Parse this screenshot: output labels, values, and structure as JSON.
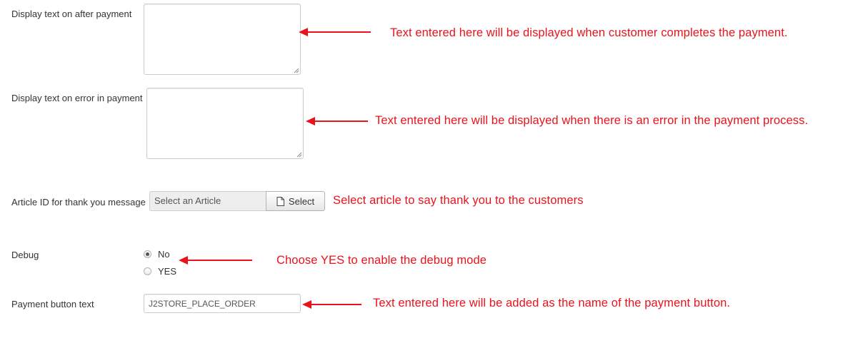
{
  "fields": {
    "after_payment": {
      "label": "Display text on after payment",
      "value": "",
      "note": "Text entered here will be displayed when customer completes the payment."
    },
    "error_payment": {
      "label": "Display text on error in payment",
      "value": "",
      "note": "Text entered here will be displayed when there is an error in the payment process."
    },
    "article": {
      "label": "Article ID for thank you message",
      "placeholder": "Select an Article",
      "button_label": "Select",
      "note": "Select article to say thank you to the customers"
    },
    "debug": {
      "label": "Debug",
      "options": [
        "No",
        "YES"
      ],
      "selected": "No",
      "note": "Choose YES to enable the debug mode"
    },
    "payment_button": {
      "label": "Payment button text",
      "value": "J2STORE_PLACE_ORDER",
      "note": "Text entered here will be added as the name of the payment button."
    }
  },
  "colors": {
    "annotation": "#e8131b",
    "label_text": "#333333",
    "field_border": "#cccccc"
  },
  "icons": {
    "select_button_icon": "document-icon",
    "resize_grip": "resize-grip-icon",
    "annotation_arrow": "left-arrow-icon"
  }
}
